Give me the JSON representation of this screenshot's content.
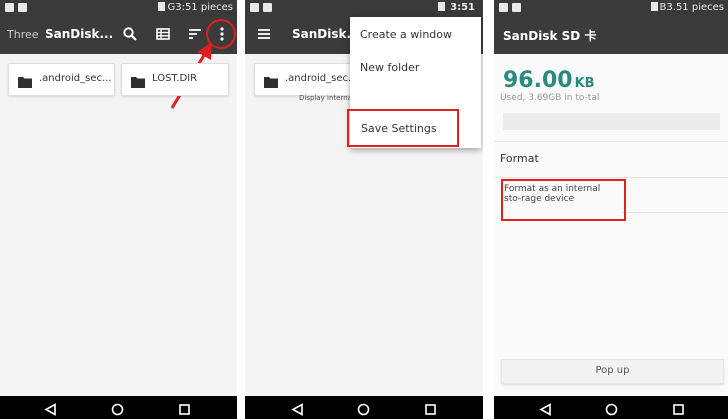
{
  "panel1": {
    "status_right": "G3:51 pieces",
    "toolbar": {
      "subtitle": "Three",
      "title": "SanDisk..."
    },
    "folders": [
      {
        "label": ".android_sec..."
      },
      {
        "label": "LOST.DIR"
      }
    ]
  },
  "panel2": {
    "status_time": "3:51",
    "toolbar": {
      "title": "SanDisk..."
    },
    "folders": [
      {
        "label": ".android_sec..."
      }
    ],
    "hint": "Display internal solution storage device",
    "menu": [
      {
        "label": "Create a window"
      },
      {
        "label": "New folder"
      },
      {
        "label": "Save Settings"
      }
    ]
  },
  "panel3": {
    "status_right": "B3.51 pieces",
    "title": "SanDisk SD 卡",
    "size_value": "96.00",
    "size_unit": "KB",
    "used_text": "Used, 3.69GB in to-tal",
    "section": "Format",
    "format_item": "Format as an internal sto-rage device",
    "popup_button": "Pop up"
  },
  "colors": {
    "toolbar": "#3b3b3b",
    "statusbar": "#3a3a3a",
    "navbar": "#000000",
    "accent_teal": "#2b8a80",
    "highlight_red": "#e02020"
  },
  "icons": [
    "search-icon",
    "list-view-icon",
    "sort-icon",
    "more-vert-icon",
    "hamburger-menu-icon",
    "folder-icon",
    "back-icon",
    "home-icon",
    "recents-icon"
  ]
}
